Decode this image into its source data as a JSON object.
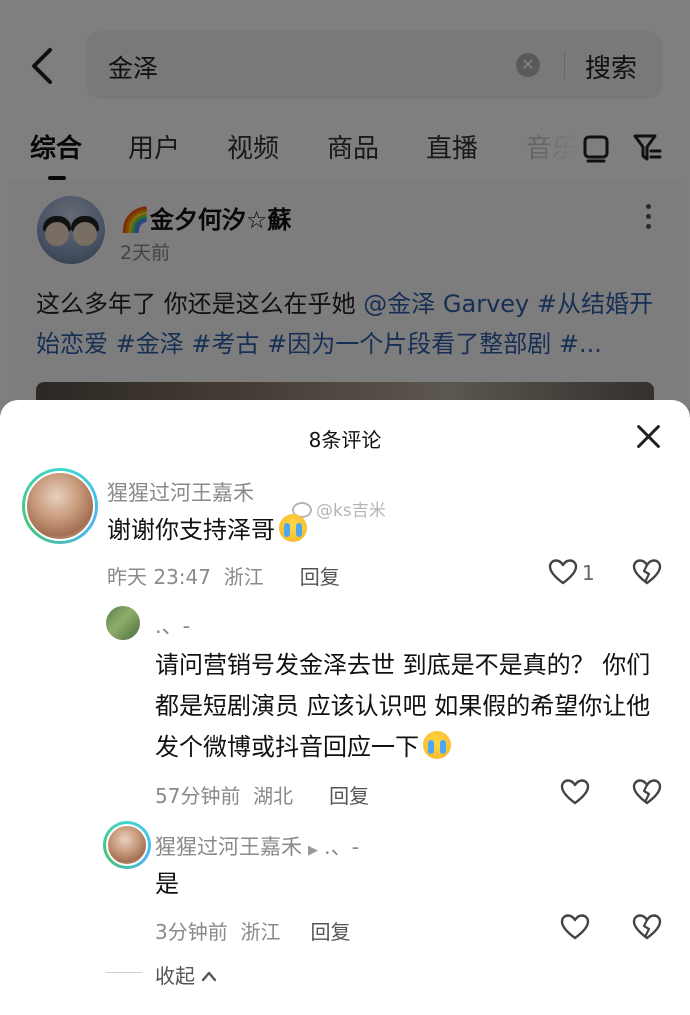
{
  "search": {
    "query": "金泽",
    "button_label": "搜索"
  },
  "tabs": [
    {
      "label": "综合",
      "active": true
    },
    {
      "label": "用户",
      "active": false
    },
    {
      "label": "视频",
      "active": false
    },
    {
      "label": "商品",
      "active": false
    },
    {
      "label": "直播",
      "active": false
    },
    {
      "label": "音乐",
      "active": false
    }
  ],
  "post": {
    "author": "🌈金夕何汐☆蘇",
    "time": "2天前",
    "text_plain": "这么多年了 你还是这么在乎她 ",
    "text_mention": "@金泽 Garvey",
    "text_tags": " #从结婚开始恋爱 #金泽 #考古 #因为一个片段看了整部剧 #..."
  },
  "sheet": {
    "title": "8条评论",
    "collapse_label": "收起",
    "watermark": "@ks吉米"
  },
  "comments": [
    {
      "name": "猩猩过河王嘉禾",
      "text": "谢谢你支持泽哥",
      "time": "昨天 23:47",
      "location": "浙江",
      "reply_label": "回复",
      "likes": "1"
    }
  ],
  "replies": [
    {
      "name": ".、-",
      "text": "请问营销号发金泽去世 到底是不是真的？ 你们都是短剧演员 应该认识吧  如果假的希望你让他发个微博或抖音回应一下",
      "time": "57分钟前",
      "location": "湖北",
      "reply_label": "回复"
    },
    {
      "name": "猩猩过河王嘉禾",
      "reply_to": ".、-",
      "text": "是",
      "time": "3分钟前",
      "location": "浙江",
      "reply_label": "回复"
    }
  ],
  "colors": {
    "link_blue": "#2f5fa8",
    "meta_gray": "#8a8a8a",
    "avatar_ring": "#3fd8d0"
  },
  "icons": [
    "back-arrow-icon",
    "clear-icon",
    "layout-icon",
    "filter-icon",
    "more-icon",
    "close-icon",
    "heart-icon",
    "dislike-icon",
    "cry-emoji-icon",
    "chevron-up-icon"
  ]
}
